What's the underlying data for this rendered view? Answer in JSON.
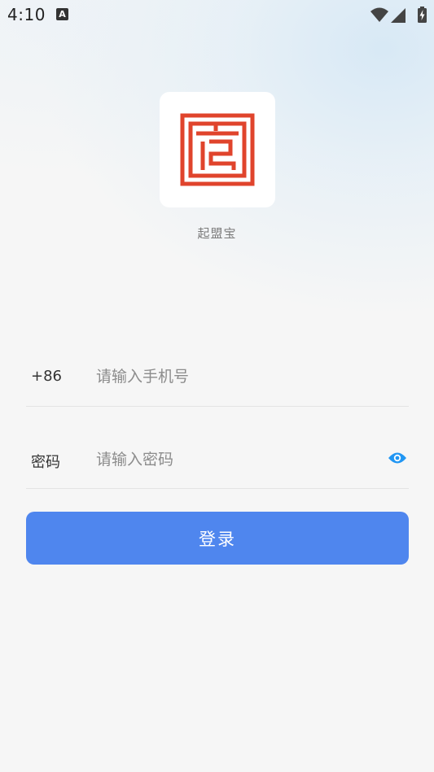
{
  "status_bar": {
    "time": "4:10",
    "notification_badge": "A",
    "icons": [
      "wifi-icon",
      "cell-signal-icon",
      "battery-charging-icon"
    ]
  },
  "brand": {
    "app_name": "起盟宝",
    "logo_color": "#e0442c"
  },
  "login_form": {
    "phone": {
      "country_code": "+86",
      "value": "",
      "placeholder": "请输入手机号"
    },
    "password": {
      "label": "密码",
      "value": "",
      "placeholder": "请输入密码",
      "toggle_icon": "eye-icon"
    },
    "submit_label": "登录"
  },
  "colors": {
    "accent": "#4f86ee",
    "eye_icon": "#2196f3",
    "background": "#f6f6f6"
  }
}
